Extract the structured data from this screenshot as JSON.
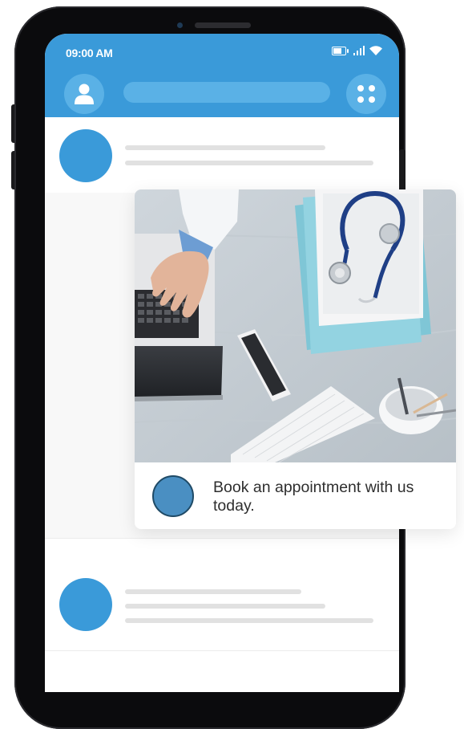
{
  "status_bar": {
    "time": "09:00 AM",
    "icons": [
      "battery-icon",
      "signal-icon",
      "wifi-icon"
    ]
  },
  "header": {
    "profile_icon": "user-icon",
    "menu_icon": "grid-icon"
  },
  "card": {
    "message": "Book an appointment with us today."
  },
  "colors": {
    "app_bar": "#3a9ad9",
    "app_bar_elements": "#5ab1e6",
    "avatar": "#3a9ad9",
    "placeholder_line": "#e1e1e1",
    "card_dot": "#4a8fc2"
  }
}
